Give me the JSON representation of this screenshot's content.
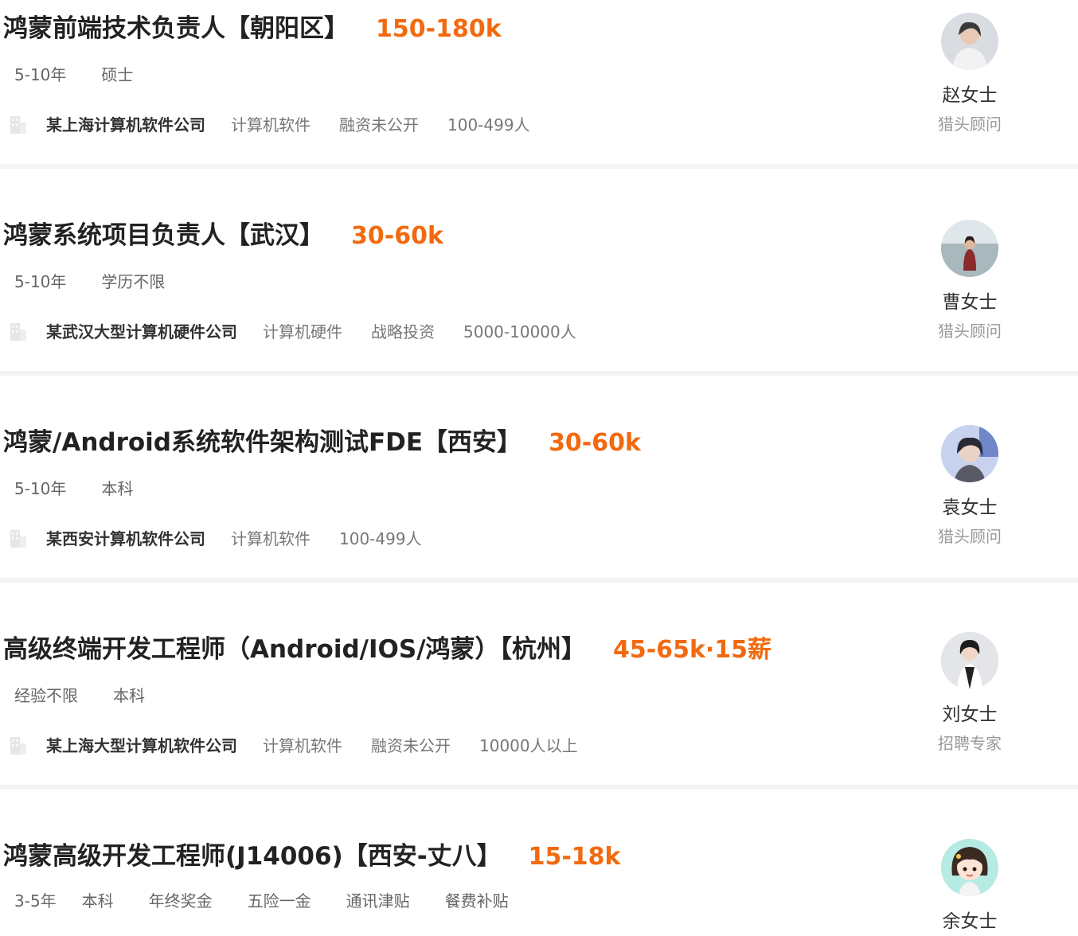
{
  "jobs": [
    {
      "title": "鸿蒙前端技术负责人【朝阳区】",
      "salary": "150-180k",
      "tags": [
        "5-10年",
        "硕士"
      ],
      "company": "某上海计算机软件公司",
      "company_info": [
        "计算机软件",
        "融资未公开",
        "100-499人"
      ],
      "recruiter_name": "赵女士",
      "recruiter_role": "猎头顾问",
      "avatar_colors": {
        "bg": "#d9dde2",
        "fg": "#7a7f86"
      }
    },
    {
      "title": "鸿蒙系统项目负责人【武汉】",
      "salary": "30-60k",
      "tags": [
        "5-10年",
        "学历不限"
      ],
      "company": "某武汉大型计算机硬件公司",
      "company_info": [
        "计算机硬件",
        "战略投资",
        "5000-10000人"
      ],
      "recruiter_name": "曹女士",
      "recruiter_role": "猎头顾问",
      "avatar_colors": {
        "bg": "#c9d4d8",
        "fg": "#8a2a2a"
      }
    },
    {
      "title": "鸿蒙/Android系统软件架构测试FDE【西安】",
      "salary": "30-60k",
      "tags": [
        "5-10年",
        "本科"
      ],
      "company": "某西安计算机软件公司",
      "company_info": [
        "计算机软件",
        "100-499人"
      ],
      "recruiter_name": "袁女士",
      "recruiter_role": "猎头顾问",
      "avatar_colors": {
        "bg": "#b8c6e6",
        "fg": "#3d3d4a"
      }
    },
    {
      "title": "高级终端开发工程师（Android/IOS/鸿蒙）【杭州】",
      "salary": "45-65k·15薪",
      "tags": [
        "经验不限",
        "本科"
      ],
      "company": "某上海大型计算机软件公司",
      "company_info": [
        "计算机软件",
        "融资未公开",
        "10000人以上"
      ],
      "recruiter_name": "刘女士",
      "recruiter_role": "招聘专家",
      "avatar_colors": {
        "bg": "#cfd2d6",
        "fg": "#2b2b2b"
      }
    },
    {
      "title": "鸿蒙高级开发工程师(J14006)【西安-丈八】",
      "salary": "15-18k",
      "tags": [
        "3-5年",
        "本科",
        "年终奖金",
        "五险一金",
        "通讯津贴",
        "餐费补贴"
      ],
      "recruiter_name": "余女士",
      "avatar_colors": {
        "bg": "#a9e3dc",
        "fg": "#3a2a22"
      }
    }
  ]
}
